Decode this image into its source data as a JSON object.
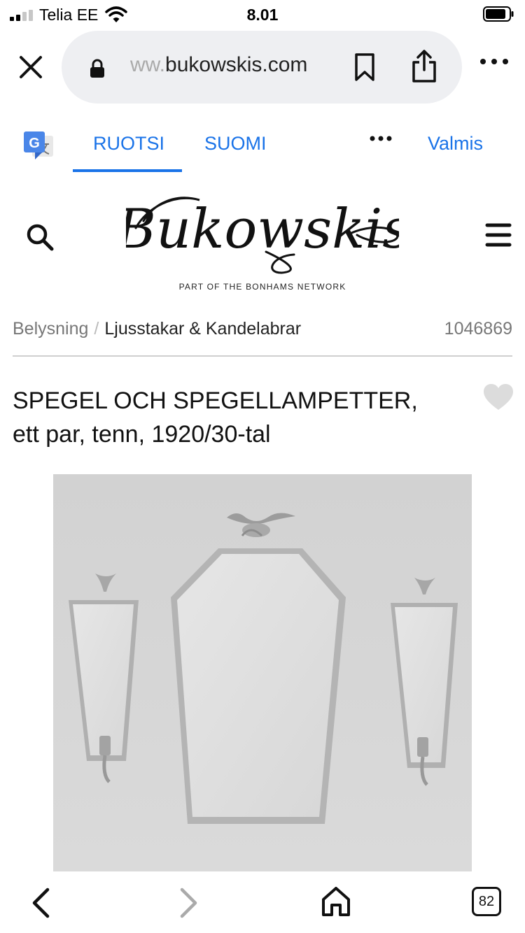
{
  "status_bar": {
    "carrier": "Telia EE",
    "time": "8.01"
  },
  "browser": {
    "url_prefix": "ww.",
    "url_domain": "bukowskis.com",
    "tab_count": "82"
  },
  "translate_bar": {
    "tabs": [
      {
        "label": "RUOTSI",
        "selected": true
      },
      {
        "label": "SUOMI",
        "selected": false
      }
    ],
    "done_label": "Valmis"
  },
  "site": {
    "logo_text": "Bukowskis",
    "tagline": "PART OF THE BONHAMS NETWORK"
  },
  "breadcrumb": {
    "items": [
      "Belysning",
      "Ljusstakar & Kandelabrar"
    ],
    "separator": "/",
    "lot_number": "1046869"
  },
  "lot": {
    "title_line1": "SPEGEL OCH SPEGELLAMPETTER,",
    "title_line2": "ett par, tenn, 1920/30-tal"
  },
  "colors": {
    "accent": "#1a73e8",
    "url_bar_bg": "#eeeff2",
    "photo_bg": "#d5d5d5",
    "heart": "#dcdcdc"
  },
  "icons": [
    "close-icon",
    "lock-icon",
    "bookmark-icon",
    "share-icon",
    "more-icon",
    "google-translate-icon",
    "search-icon",
    "menu-icon",
    "heart-icon",
    "back-icon",
    "forward-icon",
    "home-icon",
    "tabs-icon"
  ]
}
